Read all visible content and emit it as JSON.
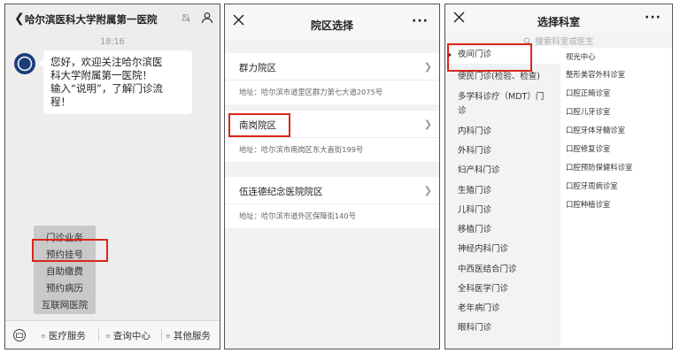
{
  "chat": {
    "title": "哈尔滨医科大学附属第一医院",
    "time": "18:16",
    "message": "您好，欢迎关注哈尔滨医\n科大学附属第一医院！\n输入“说明”，了解门诊流\n程！",
    "popup_items": [
      "门诊业务",
      "预约挂号",
      "自助缴费",
      "预约病历",
      "互联网医院"
    ],
    "menu": [
      "医疗服务",
      "查询中心",
      "其他服务"
    ]
  },
  "campus": {
    "title": "院区选择",
    "items": [
      {
        "name": "群力院区",
        "address": "地址：哈尔滨市道里区群力第七大道2075号"
      },
      {
        "name": "南岗院区",
        "address": "地址：哈尔滨市南岗区东大直街199号"
      },
      {
        "name": "伍连德纪念医院院区",
        "address": "地址：哈尔滨市道外区保障街140号"
      }
    ]
  },
  "department": {
    "title": "选择科室",
    "search_placeholder": "搜索科室或医生",
    "categories": [
      "夜间门诊",
      "便民门诊(检验、检查)",
      "多学科诊疗（MDT）门\n诊",
      "内科门诊",
      "外科门诊",
      "妇产科门诊",
      "生殖门诊",
      "儿科门诊",
      "移植门诊",
      "神经内科门诊",
      "中西医结合门诊",
      "全科医学门诊",
      "老年病门诊",
      "眼科门诊"
    ],
    "subs": [
      "视光中心",
      "整形美容外科诊室",
      "口腔正畸诊室",
      "口腔儿牙诊室",
      "口腔牙体牙髓诊室",
      "口腔修复诊室",
      "口腔预防保健科诊室",
      "口腔牙周病诊室",
      "口腔种植诊室"
    ]
  },
  "colors": {
    "highlight": "#d9261c"
  }
}
